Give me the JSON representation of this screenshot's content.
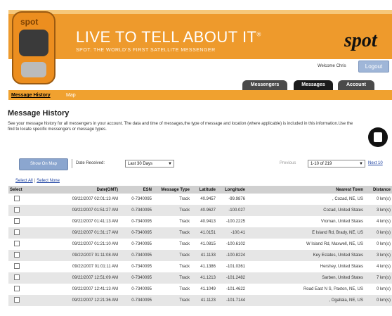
{
  "header": {
    "headline": "LIVE TO TELL ABOUT IT",
    "headline_mark": "®",
    "subline": "SPOT. THE WORLD'S FIRST SATELLITE MESSENGER",
    "device_logo": "spot",
    "logo": "spot",
    "welcome": "Welcome Chris",
    "logout_label": "Logout"
  },
  "tabs": [
    {
      "label": "Messengers",
      "active": false
    },
    {
      "label": "Messages",
      "active": true
    },
    {
      "label": "Account",
      "active": false
    }
  ],
  "subnav": {
    "history": "Message History",
    "map": "Map"
  },
  "page": {
    "title": "Message History",
    "description": "See your message history for all messengers in your account. The data and time of messages,the type of message and location (where applicable) is included in this information.Use the find to locate specific messengers or message types."
  },
  "toolbar": {
    "show_on_map": "Show On Map",
    "date_received_label": "Date Received:",
    "date_range": "Last 30 Days",
    "previous": "Previous",
    "page_range": "1-10 of 219",
    "next": "Next 10"
  },
  "selection": {
    "select_all": "Select All",
    "select_none": "Select None"
  },
  "table": {
    "headers": [
      "Select",
      "Date(GMT)",
      "ESN",
      "Message Type",
      "Latitude",
      "Longitude",
      "Nearest Town",
      "Distance"
    ],
    "rows": [
      [
        "09/22/2007 02:01:13 AM",
        "0-7340095",
        "Track",
        "40.9457",
        "-99.9876",
        ", Cozad, NE, US",
        "0 km(s)"
      ],
      [
        "09/22/2007 01:51:27 AM",
        "0-7340095",
        "Track",
        "40.9627",
        "-100.027",
        "Cozad, United States",
        "3 km(s)"
      ],
      [
        "09/22/2007 01:41:13 AM",
        "0-7340095",
        "Track",
        "40.9413",
        "-100.2225",
        "Vroman, United States",
        "4 km(s)"
      ],
      [
        "09/22/2007 01:31:17 AM",
        "0-7340095",
        "Track",
        "41.0151",
        "-100.41",
        "E Island Rd, Brady, NE, US",
        "0 km(s)"
      ],
      [
        "09/22/2007 01:21:10 AM",
        "0-7340095",
        "Track",
        "41.0815",
        "-100.6102",
        "W Island Rd, Maxwell, NE, US",
        "0 km(s)"
      ],
      [
        "09/22/2007 01:11:08 AM",
        "0-7340095",
        "Track",
        "41.1133",
        "-100.8224",
        "Key Estates, United States",
        "3 km(s)"
      ],
      [
        "09/22/2007 01:01:11 AM",
        "0-7340095",
        "Track",
        "41.1386",
        "-101.0361",
        "Hershey, United States",
        "4 km(s)"
      ],
      [
        "09/22/2007 12:51:09 AM",
        "0-7340095",
        "Track",
        "41.1213",
        "-101.2482",
        "Sarben, United States",
        "7 km(s)"
      ],
      [
        "09/22/2007 12:41:13 AM",
        "0-7340095",
        "Track",
        "41.1049",
        "-101.4622",
        "Road East N S, Paxton, NE, US",
        "0 km(s)"
      ],
      [
        "09/22/2007 12:21:36 AM",
        "0-7340095",
        "Track",
        "41.1123",
        "-101.7144",
        ", Ogallala, NE, US",
        "0 km(s)"
      ]
    ]
  }
}
